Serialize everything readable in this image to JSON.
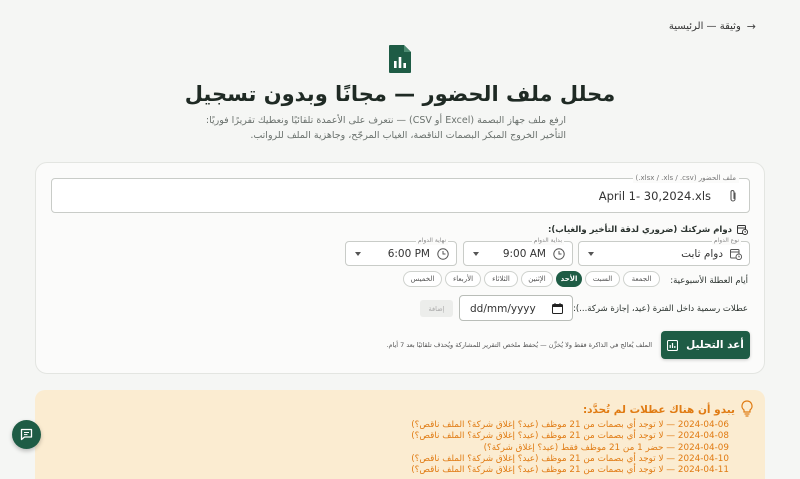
{
  "nav": {
    "back_label": "وثيقة — الرئيسية"
  },
  "hero": {
    "title": "محلل ملف الحضور — مجانًا وبدون تسجيل",
    "subtitle": "ارفع ملف جهاز البصمة (Excel أو CSV) — نتعرف على الأعمدة تلقائيًا ونعطيك تقريرًا فوريًا: التأخير الخروج المبكر البصمات الناقصة، الغياب المرجّح، وجاهزية الملف للرواتب."
  },
  "upload": {
    "legend": "ملف الحضور (xlsx / .xls / .csv.)",
    "file_name": "April 1- 30,2024.xls"
  },
  "shift": {
    "label": "دوام شركتك (ضروري لدقة التأخير والغياب):",
    "type_legend": "نوع الدوام",
    "type_value": "دوام ثابت",
    "start_legend": "بداية الدوام",
    "start_value": "9:00 AM",
    "end_legend": "نهاية الدوام",
    "end_value": "6:00 PM"
  },
  "weekend": {
    "label": "أيام العطلة الأسبوعية:",
    "days": [
      {
        "label": "الجمعة",
        "active": false
      },
      {
        "label": "السبت",
        "active": false
      },
      {
        "label": "الأحد",
        "active": true
      },
      {
        "label": "الإثنين",
        "active": false
      },
      {
        "label": "الثلاثاء",
        "active": false
      },
      {
        "label": "الأربعاء",
        "active": false
      },
      {
        "label": "الخميس",
        "active": false
      }
    ]
  },
  "holidays": {
    "label": "عطلات رسمية داخل الفترة (عيد، إجازة شركة...):",
    "date_placeholder": "dd/mm/yyyy",
    "add_label": "إضافة"
  },
  "actions": {
    "analyze_label": "أعد التحليل",
    "privacy_note": "الملف يُعالج في الذاكرة فقط ولا يُخزَّن — يُحفظ ملخص التقرير للمشاركة ويُحذف تلقائيًا بعد 7 أيام."
  },
  "alert": {
    "heading": "يبدو أن هناك عطلات لم تُحدَّد:",
    "items": [
      "2024-04-06 — لا توجد أي بصمات من 21 موظف (عيد؟ إغلاق شركة؟ الملف ناقص؟)",
      "2024-04-08 — لا توجد أي بصمات من 21 موظف (عيد؟ إغلاق شركة؟ الملف ناقص؟)",
      "2024-04-09 — حضر 1 من 21 موظف فقط (عيد؟ إغلاق شركة؟)",
      "2024-04-10 — لا توجد أي بصمات من 21 موظف (عيد؟ إغلاق شركة؟ الملف ناقص؟)",
      "2024-04-11 — لا توجد أي بصمات من 21 موظف (عيد؟ إغلاق شركة؟ الملف ناقص؟)"
    ]
  },
  "colors": {
    "primary": "#1e5c45",
    "warning": "#e07b13",
    "warning_bg": "#fbecd1"
  }
}
